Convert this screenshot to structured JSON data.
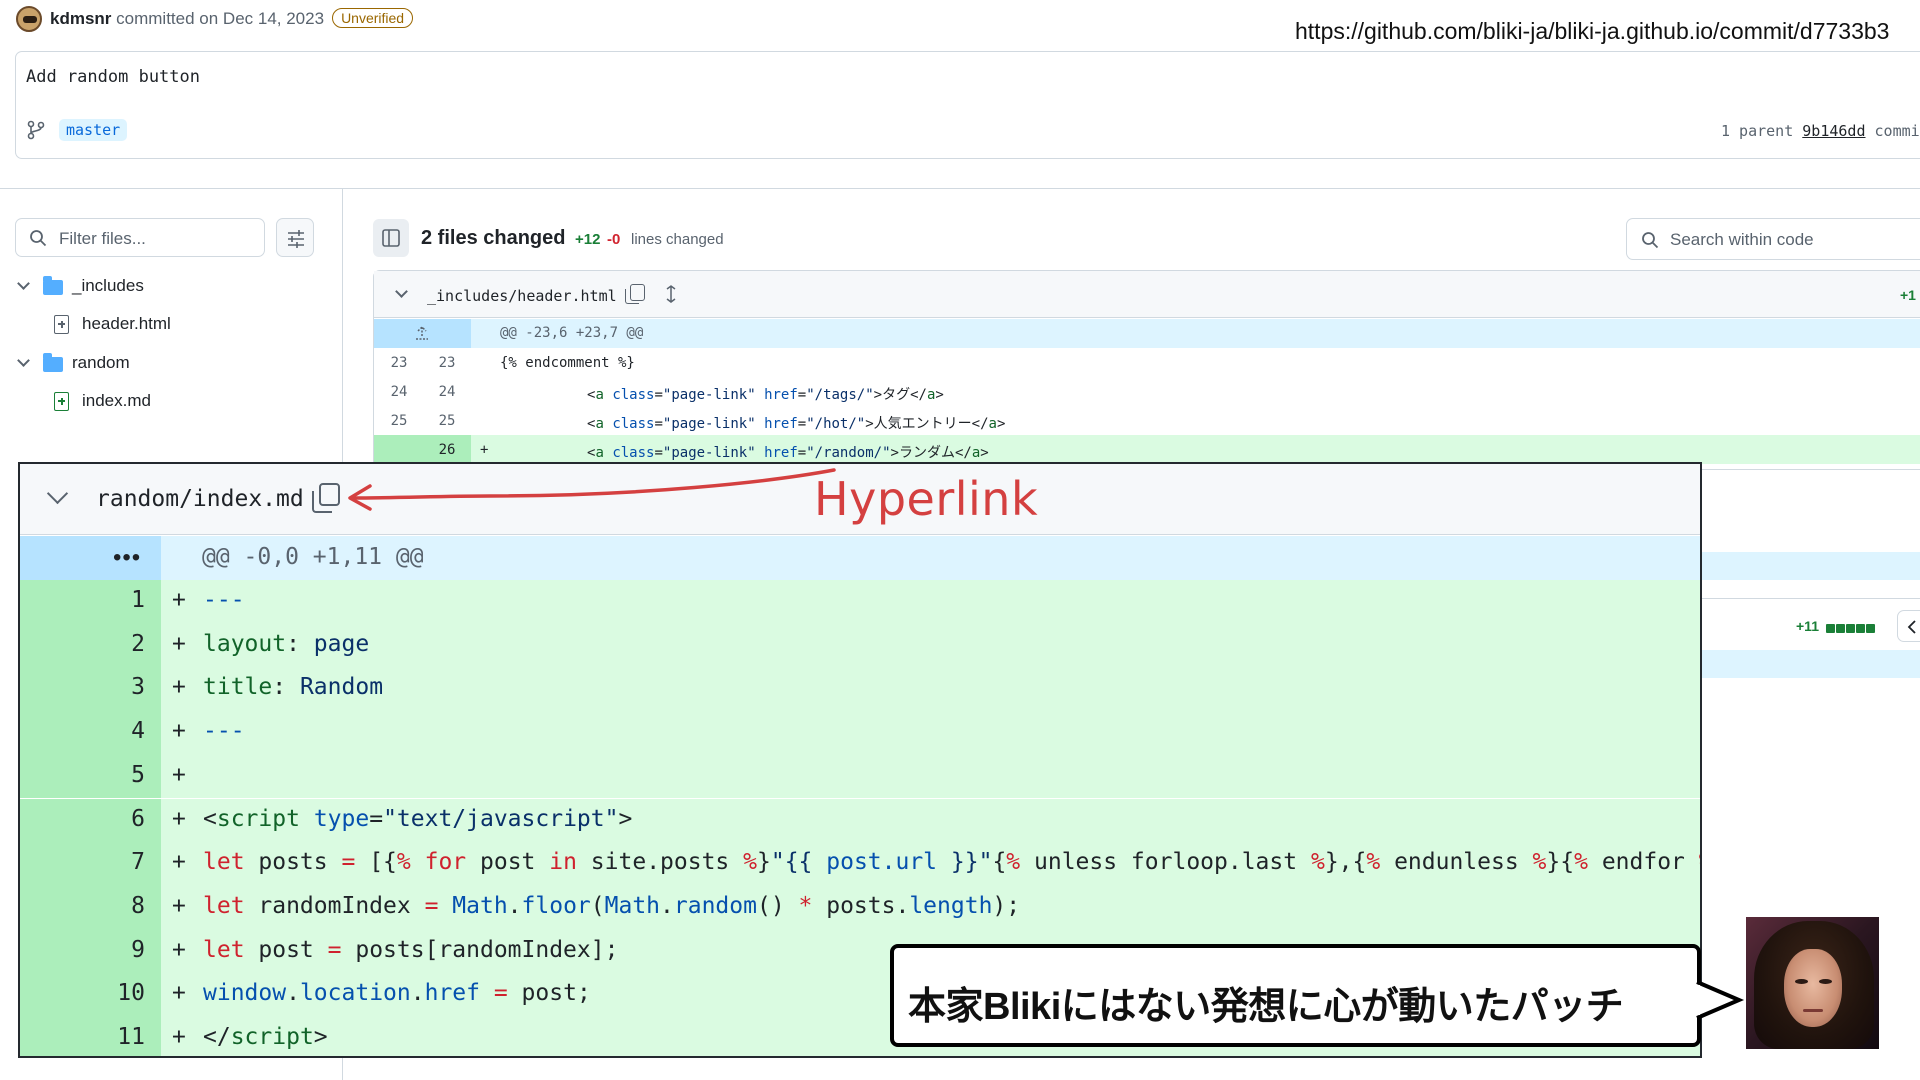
{
  "commit": {
    "author": "kdmsnr",
    "committed_text": "committed on Dec 14, 2023",
    "badge": "Unverified",
    "url": "https://github.com/bliki-ja/bliki-ja.github.io/commit/d7733b3",
    "message": "Add random button",
    "branch": "master",
    "parent_label": "1 parent",
    "parent_sha": "9b146dd",
    "commit_label": "commit"
  },
  "sidebar": {
    "filter_placeholder": "Filter files...",
    "tree": [
      {
        "type": "folder",
        "label": "_includes"
      },
      {
        "type": "file",
        "label": "header.html",
        "status": "modified"
      },
      {
        "type": "folder",
        "label": "random"
      },
      {
        "type": "file",
        "label": "index.md",
        "status": "added"
      }
    ]
  },
  "summary": {
    "files_changed": "2 files changed",
    "additions": "+12",
    "deletions": "-0",
    "lines_changed": "lines changed",
    "search_placeholder": "Search within code"
  },
  "diff1": {
    "filename": "_includes/header.html",
    "stat": "+1",
    "hunk": "@@ -23,6 +23,7 @@",
    "lines": [
      {
        "old": "23",
        "new": "23",
        "sign": "",
        "type": "context"
      },
      {
        "old": "24",
        "new": "24",
        "sign": "",
        "type": "context"
      },
      {
        "old": "25",
        "new": "25",
        "sign": "",
        "type": "context"
      },
      {
        "old": "",
        "new": "26",
        "sign": "+",
        "type": "add"
      }
    ]
  },
  "diff2": {
    "stat": "+11"
  },
  "zoom": {
    "filename": "random/index.md",
    "dots": "•••",
    "hunk": "@@ -0,0 +1,11 @@",
    "line_numbers": [
      "1",
      "2",
      "3",
      "4",
      "5",
      "6",
      "7",
      "8",
      "9",
      "10",
      "11"
    ],
    "sign": "+"
  },
  "annotations": {
    "hyperlink": "Hyperlink",
    "bubble": "本家Blikiにはない発想に心が動いたパッチ"
  },
  "colors": {
    "add_bg": "#dafbe1",
    "add_gutter": "#aceebb",
    "hunk_bg": "#ddf4ff",
    "annotation_red": "#d44040"
  }
}
